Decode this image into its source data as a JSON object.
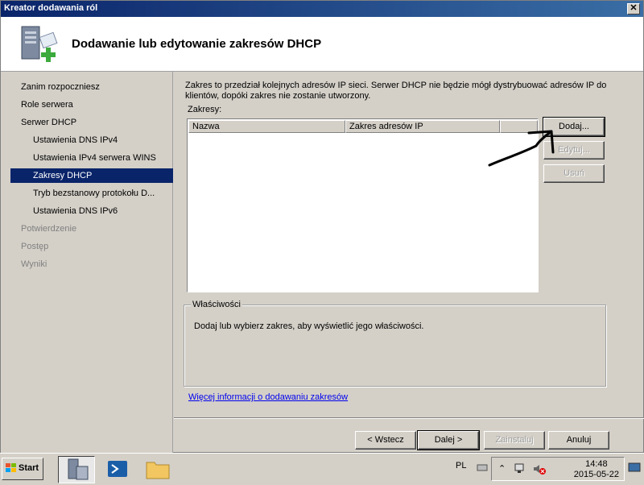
{
  "window": {
    "title": "Kreator dodawania ról",
    "close_glyph": "✕"
  },
  "header": {
    "title": "Dodawanie lub edytowanie zakresów DHCP",
    "icon": "server-add-icon"
  },
  "nav": {
    "items": [
      {
        "label": "Zanim rozpoczniesz",
        "state": "normal"
      },
      {
        "label": "Role serwera",
        "state": "normal"
      },
      {
        "label": "Serwer DHCP",
        "state": "normal"
      },
      {
        "label": "Ustawienia DNS IPv4",
        "state": "normal"
      },
      {
        "label": "Ustawienia IPv4 serwera WINS",
        "state": "normal"
      },
      {
        "label": "Zakresy DHCP",
        "state": "active"
      },
      {
        "label": "Tryb bezstanowy protokołu D...",
        "state": "normal"
      },
      {
        "label": "Ustawienia DNS IPv6",
        "state": "normal"
      },
      {
        "label": "Potwierdzenie",
        "state": "disabled"
      },
      {
        "label": "Postęp",
        "state": "disabled"
      },
      {
        "label": "Wyniki",
        "state": "disabled"
      }
    ]
  },
  "main": {
    "description": "Zakres to przedział kolejnych adresów IP sieci. Serwer DHCP nie będzie mógł dystrybuować adresów IP do klientów, dopóki zakres nie zostanie utworzony.",
    "scopes_label": "Zakresy:",
    "columns": [
      "Nazwa",
      "Zakres adresów IP",
      ""
    ],
    "rows": [],
    "buttons": {
      "add": "Dodaj...",
      "edit": "Edytuj...",
      "remove": "Usuń"
    },
    "properties_title": "Właściwości",
    "properties_text": "Dodaj lub wybierz zakres, aby wyświetlić jego właściwości.",
    "more_info_link": "Więcej informacji o dodawaniu zakresów"
  },
  "footer": {
    "back": "< Wstecz",
    "next": "Dalej >",
    "install": "Zainstaluj",
    "cancel": "Anuluj"
  },
  "taskbar": {
    "start_label": "Start",
    "language": "PL",
    "time": "14:48",
    "date": "2015-05-22",
    "apps": [
      "server-manager-icon",
      "powershell-icon",
      "explorer-folder-icon"
    ]
  },
  "colors": {
    "selection": "#0a246a",
    "titlebar": "#0a246a",
    "link": "#0000ee",
    "annotation_arrow": "#000000"
  }
}
